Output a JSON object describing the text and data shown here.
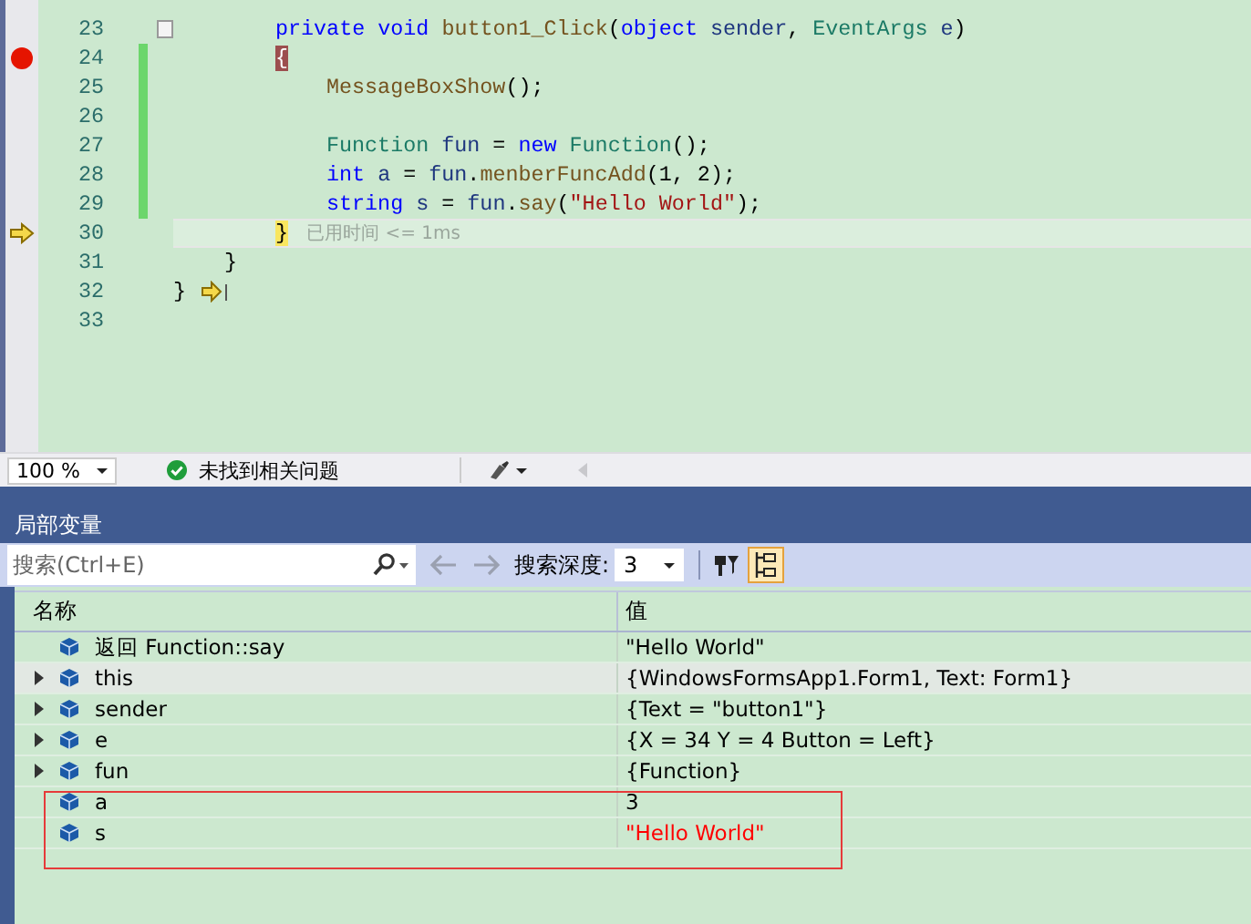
{
  "editor": {
    "lines": [
      {
        "number": "23",
        "kind": "member",
        "breakpoint": false,
        "current": false,
        "changed": false,
        "collapse": true,
        "tokens": [
          {
            "kind": "keyword",
            "text": "private void "
          },
          {
            "kind": "method",
            "text": "button1_Click"
          },
          {
            "kind": "plain",
            "text": "("
          },
          {
            "kind": "keyword",
            "text": "object "
          },
          {
            "kind": "param",
            "text": "sender"
          },
          {
            "kind": "plain",
            "text": ", "
          },
          {
            "kind": "type",
            "text": "EventArgs "
          },
          {
            "kind": "param",
            "text": "e"
          },
          {
            "kind": "plain",
            "text": ")"
          }
        ]
      },
      {
        "number": "24",
        "kind": "member",
        "breakpoint": true,
        "current": false,
        "changed": true,
        "collapse": false,
        "tokens": [
          {
            "kind": "brace-match",
            "text": "{"
          }
        ]
      },
      {
        "number": "25",
        "kind": "body",
        "breakpoint": false,
        "current": false,
        "changed": true,
        "collapse": false,
        "tokens": [
          {
            "kind": "method",
            "text": "MessageBoxShow"
          },
          {
            "kind": "plain",
            "text": "();"
          }
        ]
      },
      {
        "number": "26",
        "kind": "body",
        "breakpoint": false,
        "current": false,
        "changed": true,
        "collapse": false
      },
      {
        "number": "27",
        "kind": "body",
        "breakpoint": false,
        "current": false,
        "changed": true,
        "collapse": false,
        "tokens": [
          {
            "kind": "type",
            "text": "Function "
          },
          {
            "kind": "param",
            "text": "fun"
          },
          {
            "kind": "plain",
            "text": " = "
          },
          {
            "kind": "keyword",
            "text": "new "
          },
          {
            "kind": "type",
            "text": "Function"
          },
          {
            "kind": "plain",
            "text": "();"
          }
        ]
      },
      {
        "number": "28",
        "kind": "body",
        "breakpoint": false,
        "current": false,
        "changed": true,
        "collapse": false,
        "tokens": [
          {
            "kind": "keyword",
            "text": "int "
          },
          {
            "kind": "param",
            "text": "a"
          },
          {
            "kind": "plain",
            "text": " = "
          },
          {
            "kind": "param",
            "text": "fun"
          },
          {
            "kind": "plain",
            "text": "."
          },
          {
            "kind": "method",
            "text": "menberFuncAdd"
          },
          {
            "kind": "plain",
            "text": "(1, 2);"
          }
        ]
      },
      {
        "number": "29",
        "kind": "body",
        "breakpoint": false,
        "current": false,
        "changed": true,
        "collapse": false,
        "tokens": [
          {
            "kind": "keyword",
            "text": "string "
          },
          {
            "kind": "param",
            "text": "s"
          },
          {
            "kind": "plain",
            "text": " = "
          },
          {
            "kind": "param",
            "text": "fun"
          },
          {
            "kind": "plain",
            "text": "."
          },
          {
            "kind": "method",
            "text": "say"
          },
          {
            "kind": "plain",
            "text": "("
          },
          {
            "kind": "string",
            "text": "\"Hello World\""
          },
          {
            "kind": "plain",
            "text": ");"
          }
        ]
      },
      {
        "number": "30",
        "kind": "member",
        "breakpoint": false,
        "current": true,
        "changed": false,
        "collapse": false,
        "tokens": [
          {
            "kind": "brace-current",
            "text": "}"
          },
          {
            "kind": "perf",
            "text": "已用时间 <= 1ms"
          }
        ]
      },
      {
        "number": "31",
        "kind": "class",
        "breakpoint": false,
        "current": false,
        "changed": false,
        "collapse": false,
        "tokens": [
          {
            "kind": "plain",
            "text": "}"
          }
        ]
      },
      {
        "number": "32",
        "kind": "namespace",
        "breakpoint": false,
        "current": false,
        "changed": false,
        "collapse": false,
        "tokens": [
          {
            "kind": "plain",
            "text": "}"
          },
          {
            "kind": "step-arrow"
          }
        ]
      },
      {
        "number": "33",
        "kind": "namespace",
        "breakpoint": false,
        "current": false,
        "changed": false,
        "collapse": false
      }
    ]
  },
  "status_bar": {
    "zoom": "100 %",
    "issues": "未找到相关问题"
  },
  "locals": {
    "title": "局部变量",
    "search": {
      "placeholder": "搜索(Ctrl+E)"
    },
    "depth_label": "搜索深度:",
    "depth": "3",
    "group_toggle_on": true,
    "columns": [
      "名称",
      "值"
    ],
    "rows": [
      {
        "name": "返回 Function::say",
        "value": "\"Hello World\"",
        "expandable": false,
        "selected": false,
        "changed": false
      },
      {
        "name": "this",
        "value": "{WindowsFormsApp1.Form1, Text: Form1}",
        "expandable": true,
        "selected": true,
        "changed": false
      },
      {
        "name": "sender",
        "value": "{Text = \"button1\"}",
        "expandable": true,
        "selected": false,
        "changed": false
      },
      {
        "name": "e",
        "value": "{X = 34 Y = 4 Button = Left}",
        "expandable": true,
        "selected": false,
        "changed": false
      },
      {
        "name": "fun",
        "value": "{Function}",
        "expandable": true,
        "selected": false,
        "changed": false
      },
      {
        "name": "a",
        "value": "3",
        "expandable": false,
        "selected": false,
        "changed": false
      },
      {
        "name": "s",
        "value": "\"Hello World\"",
        "expandable": false,
        "selected": false,
        "changed": true
      }
    ]
  }
}
